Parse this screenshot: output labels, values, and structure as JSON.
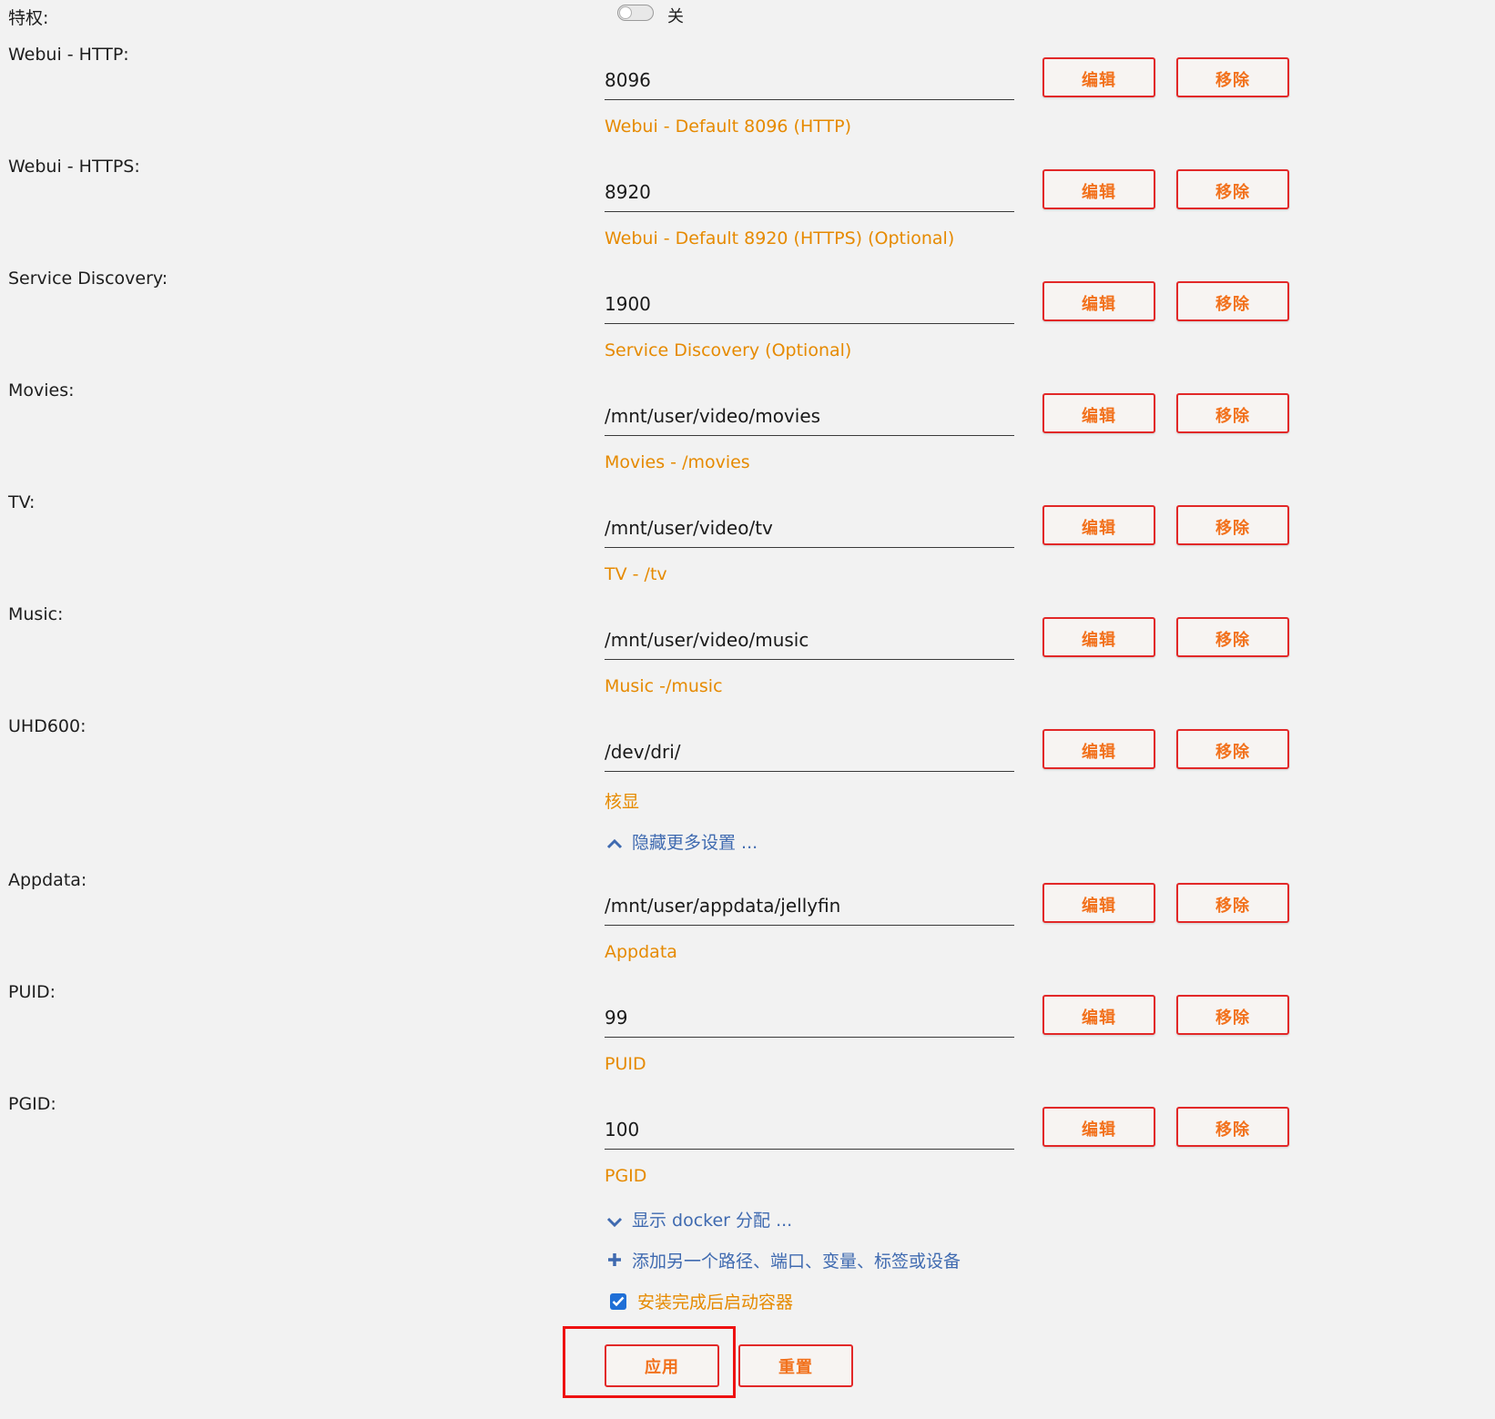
{
  "privileged": {
    "label": "特权:",
    "state_label": "关",
    "enabled": false
  },
  "buttons": {
    "edit_label": "编辑",
    "remove_label": "移除"
  },
  "entries": [
    {
      "label": "Webui - HTTP:",
      "value": "8096",
      "description": "Webui - Default 8096 (HTTP)"
    },
    {
      "label": "Webui - HTTPS:",
      "value": "8920",
      "description": "Webui - Default 8920 (HTTPS) (Optional)"
    },
    {
      "label": "Service Discovery:",
      "value": "1900",
      "description": "Service Discovery (Optional)"
    },
    {
      "label": "Movies:",
      "value": "/mnt/user/video/movies",
      "description": "Movies - /movies"
    },
    {
      "label": "TV:",
      "value": "/mnt/user/video/tv",
      "description": "TV - /tv"
    },
    {
      "label": "Music:",
      "value": "/mnt/user/video/music",
      "description": "Music -/music"
    },
    {
      "label": "UHD600:",
      "value": "/dev/dri/",
      "description": "核显"
    },
    {
      "label": "Appdata:",
      "value": "/mnt/user/appdata/jellyfin",
      "description": "Appdata"
    },
    {
      "label": "PUID:",
      "value": "99",
      "description": "PUID"
    },
    {
      "label": "PGID:",
      "value": "100",
      "description": "PGID"
    }
  ],
  "links": {
    "hide_more": "隐藏更多设置 ...",
    "show_docker": "显示 docker 分配 ...",
    "add_another": "添加另一个路径、端口、变量、标签或设备"
  },
  "start_after_install": {
    "label": "安装完成后启动容器",
    "checked": true
  },
  "actions": {
    "apply_label": "应用",
    "reset_label": "重置"
  },
  "colors": {
    "accent_orange": "#f2711c",
    "description_orange": "#e68a00",
    "button_border_red": "#e22828",
    "link_blue": "#3f6ab0",
    "checkbox_blue": "#1f6fd6",
    "highlight_red": "#ee1111",
    "background": "#f2f2f2"
  }
}
